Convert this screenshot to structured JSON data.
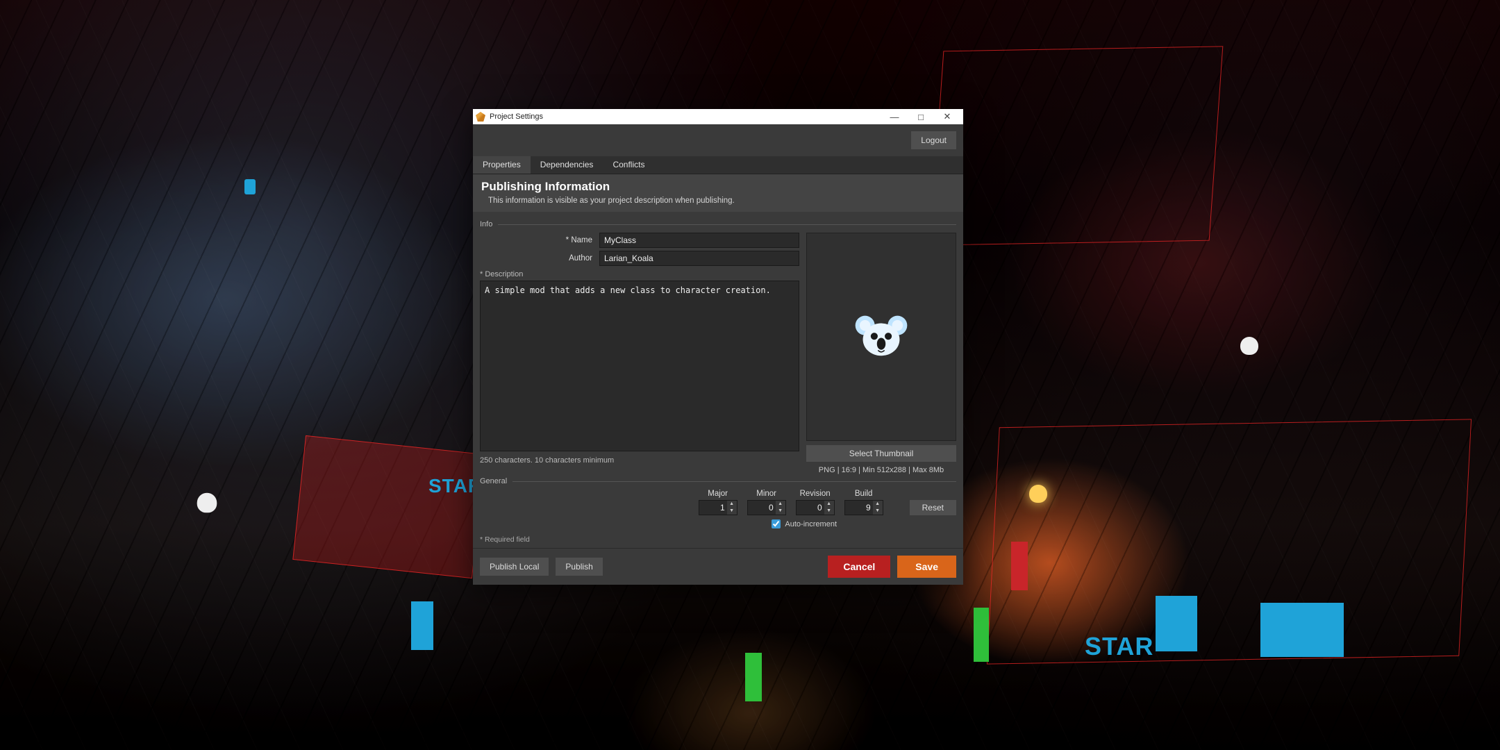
{
  "window": {
    "title": "Project Settings",
    "minimize": "—",
    "maximize": "□",
    "close": "✕"
  },
  "topbar": {
    "logout": "Logout"
  },
  "tabs": {
    "properties": "Properties",
    "dependencies": "Dependencies",
    "conflicts": "Conflicts"
  },
  "header": {
    "title": "Publishing Information",
    "subtitle": "This information is visible as your project description when publishing."
  },
  "groups": {
    "info": "Info",
    "general": "General"
  },
  "fields": {
    "name_label": "Name",
    "name_value": "MyClass",
    "author_label": "Author",
    "author_value": "Larian_Koala",
    "description_label": "* Description",
    "description_value": "A simple mod that adds a new class to character creation.",
    "description_hint": "250 characters. 10 characters minimum"
  },
  "thumbnail": {
    "select": "Select Thumbnail",
    "spec": "PNG | 16:9 | Min 512x288 | Max 8Mb"
  },
  "version": {
    "major_label": "Major",
    "major": "1",
    "minor_label": "Minor",
    "minor": "0",
    "revision_label": "Revision",
    "revision": "0",
    "build_label": "Build",
    "build": "9",
    "reset": "Reset",
    "autoincrement": "Auto-increment",
    "autoincrement_checked": true
  },
  "required_note": "* Required field",
  "footer": {
    "publish_local": "Publish Local",
    "publish": "Publish",
    "cancel": "Cancel",
    "save": "Save"
  },
  "scene_labels": {
    "star_left": "STAR",
    "star_right": "STAR"
  }
}
